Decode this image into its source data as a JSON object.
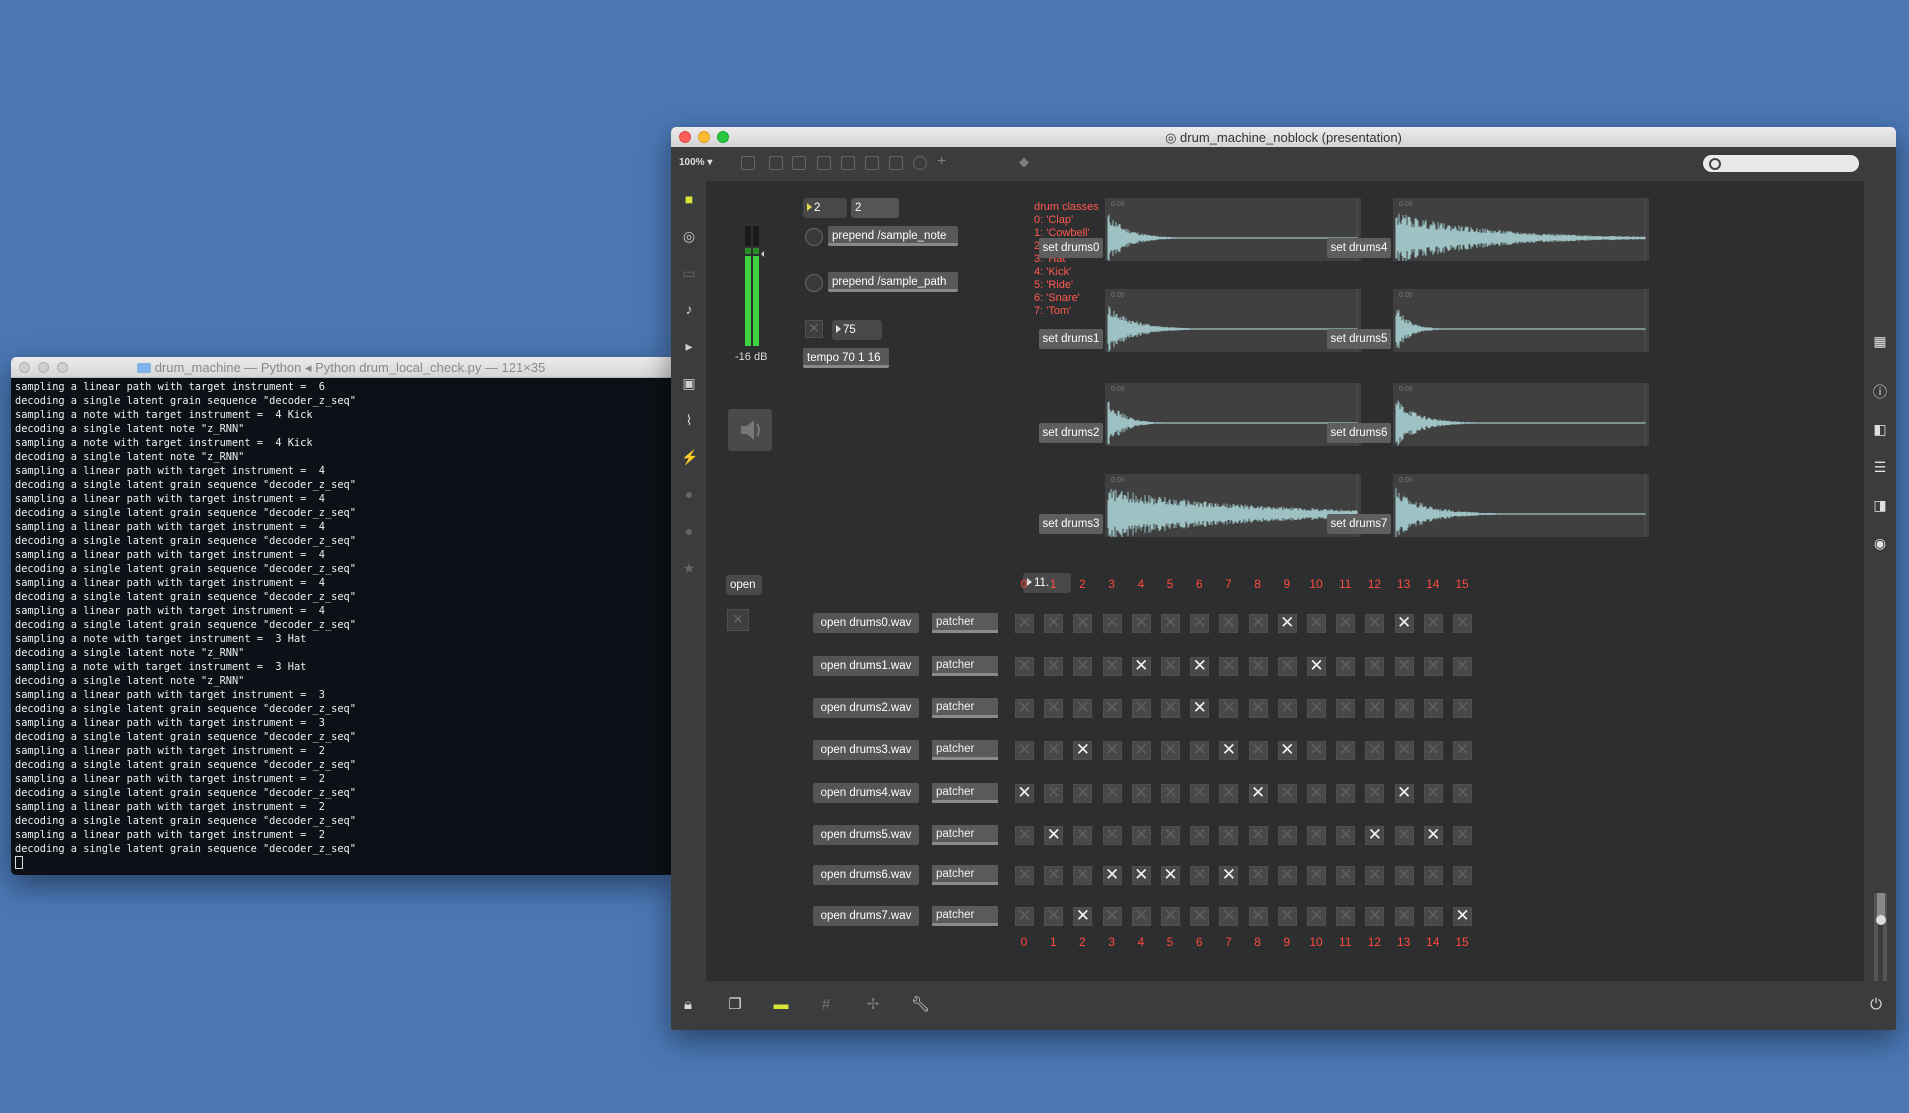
{
  "terminal": {
    "title": "drum_machine — Python ◂ Python drum_local_check.py — 121×35",
    "lines": [
      "sampling a linear path with target instrument =  6",
      "decoding a single latent grain sequence \"decoder_z_seq\"",
      "sampling a note with target instrument =  4 Kick",
      "decoding a single latent note \"z_RNN\"",
      "sampling a note with target instrument =  4 Kick",
      "decoding a single latent note \"z_RNN\"",
      "sampling a linear path with target instrument =  4",
      "decoding a single latent grain sequence \"decoder_z_seq\"",
      "sampling a linear path with target instrument =  4",
      "decoding a single latent grain sequence \"decoder_z_seq\"",
      "sampling a linear path with target instrument =  4",
      "decoding a single latent grain sequence \"decoder_z_seq\"",
      "sampling a linear path with target instrument =  4",
      "decoding a single latent grain sequence \"decoder_z_seq\"",
      "sampling a linear path with target instrument =  4",
      "decoding a single latent grain sequence \"decoder_z_seq\"",
      "sampling a linear path with target instrument =  4",
      "decoding a single latent grain sequence \"decoder_z_seq\"",
      "sampling a note with target instrument =  3 Hat",
      "decoding a single latent note \"z_RNN\"",
      "sampling a note with target instrument =  3 Hat",
      "decoding a single latent note \"z_RNN\"",
      "sampling a linear path with target instrument =  3",
      "decoding a single latent grain sequence \"decoder_z_seq\"",
      "sampling a linear path with target instrument =  3",
      "decoding a single latent grain sequence \"decoder_z_seq\"",
      "sampling a linear path with target instrument =  2",
      "decoding a single latent grain sequence \"decoder_z_seq\"",
      "sampling a linear path with target instrument =  2",
      "decoding a single latent grain sequence \"decoder_z_seq\"",
      "sampling a linear path with target instrument =  2",
      "decoding a single latent grain sequence \"decoder_z_seq\"",
      "sampling a linear path with target instrument =  2",
      "decoding a single latent grain sequence \"decoder_z_seq\""
    ]
  },
  "max": {
    "title": "drum_machine_noblock (presentation)",
    "zoom": "100%",
    "meter_db": "-16 dB",
    "num_a": "2",
    "num_b": "2",
    "prepend_note": "prepend /sample_note",
    "prepend_path": "prepend /sample_path",
    "tempo_num": "75",
    "tempo_msg": "tempo 70 1 16",
    "open_btn": "open",
    "step_num": "11.",
    "drum_classes": "drum classes\n0: 'Clap'\n1: 'Cowbell'\n2: 'Crash'\n3: 'Hat'\n4: 'Kick'\n5: 'Ride'\n6: 'Snare'\n7: 'Tom'",
    "set_buttons": [
      "set drums0",
      "set drums1",
      "set drums2",
      "set drums3",
      "set drums4",
      "set drums5",
      "set drums6",
      "set drums7"
    ],
    "open_buttons": [
      "open drums0.wav",
      "open drums1.wav",
      "open drums2.wav",
      "open drums3.wav",
      "open drums4.wav",
      "open drums5.wav",
      "open drums6.wav",
      "open drums7.wav"
    ],
    "patcher_label": "patcher",
    "wave_db_label": "0.00",
    "columns": [
      "0",
      "1",
      "2",
      "3",
      "4",
      "5",
      "6",
      "7",
      "8",
      "9",
      "10",
      "11",
      "12",
      "13",
      "14",
      "15"
    ],
    "grid": [
      [
        0,
        0,
        0,
        0,
        0,
        0,
        0,
        0,
        0,
        1,
        0,
        0,
        0,
        1,
        0,
        0
      ],
      [
        0,
        0,
        0,
        0,
        1,
        0,
        1,
        0,
        0,
        0,
        1,
        0,
        0,
        0,
        0,
        0
      ],
      [
        0,
        0,
        0,
        0,
        0,
        0,
        1,
        0,
        0,
        0,
        0,
        0,
        0,
        0,
        0,
        0
      ],
      [
        0,
        0,
        1,
        0,
        0,
        0,
        0,
        1,
        0,
        1,
        0,
        0,
        0,
        0,
        0,
        0
      ],
      [
        1,
        0,
        0,
        0,
        0,
        0,
        0,
        0,
        1,
        0,
        0,
        0,
        0,
        1,
        0,
        0
      ],
      [
        0,
        1,
        0,
        0,
        0,
        0,
        0,
        0,
        0,
        0,
        0,
        0,
        1,
        0,
        1,
        0
      ],
      [
        0,
        0,
        0,
        1,
        1,
        1,
        0,
        1,
        0,
        0,
        0,
        0,
        0,
        0,
        0,
        0
      ],
      [
        0,
        0,
        1,
        0,
        0,
        0,
        0,
        0,
        0,
        0,
        0,
        0,
        0,
        0,
        0,
        1
      ]
    ],
    "accent": "#ff4a3f",
    "wave_color": "#b7e3e6"
  }
}
